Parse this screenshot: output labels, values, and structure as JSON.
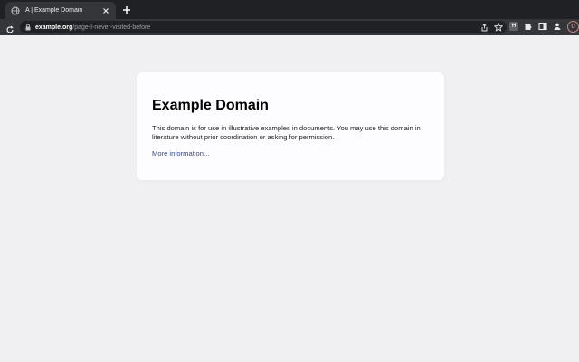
{
  "browser": {
    "tab": {
      "title": "A | Example Domain",
      "icon": "globe-icon"
    },
    "omnibox": {
      "host": "example.org",
      "path": "/page-I-never-visited-before"
    },
    "extension_label": "H",
    "avatar_initial": "U",
    "colors": {
      "tabstrip": "#202124",
      "toolbar": "#35363a",
      "omnibox": "#202124"
    }
  },
  "page": {
    "heading": "Example Domain",
    "body": "This domain is for use in illustrative examples in documents. You may use this domain in literature without prior coordination or asking for permission.",
    "link": "More information...",
    "colors": {
      "background": "#f0f0f2",
      "card": "#fdfdff",
      "link": "#38488f"
    }
  }
}
